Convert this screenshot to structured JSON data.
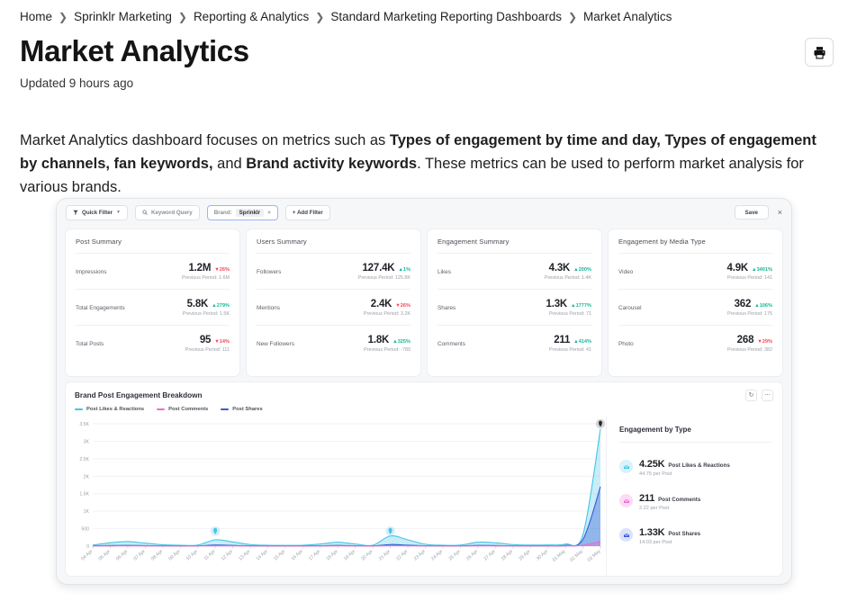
{
  "breadcrumb": [
    "Home",
    "Sprinklr Marketing",
    "Reporting & Analytics",
    "Standard Marketing Reporting Dashboards",
    "Market Analytics"
  ],
  "page": {
    "title": "Market Analytics",
    "updated": "Updated 9 hours ago",
    "print_icon": "print-icon"
  },
  "intro": {
    "p1": "Market Analytics dashboard focuses on metrics such as ",
    "b1": "Types of engagement by time and day, Types of engagement by channels, fan keywords,",
    "p2": " and ",
    "b2": "Brand activity keywords",
    "p3": ". These metrics can be used to perform market analysis for various brands."
  },
  "dashboard": {
    "toolbar": {
      "quick_filter": "Quick Filter",
      "keyword_query": "Keyword Query",
      "brand_label": "Brand:",
      "brand_value": "Sprinklr",
      "brand_remove": "×",
      "add_filter": "+ Add Filter",
      "save": "Save",
      "close": "×"
    },
    "kpi_cards": [
      {
        "title": "Post Summary",
        "items": [
          {
            "label": "Impressions",
            "value": "1.2M",
            "delta": "▼26%",
            "dir": "down",
            "prev": "Previous Period: 1.6M"
          },
          {
            "label": "Total Engagements",
            "value": "5.8K",
            "delta": "▲279%",
            "dir": "up",
            "prev": "Previous Period: 1.5K"
          },
          {
            "label": "Total Posts",
            "value": "95",
            "delta": "▼14%",
            "dir": "down",
            "prev": "Previous Period: 111"
          }
        ]
      },
      {
        "title": "Users Summary",
        "items": [
          {
            "label": "Followers",
            "value": "127.4K",
            "delta": "▲1%",
            "dir": "up",
            "prev": "Previous Period: 125.8K"
          },
          {
            "label": "Mentions",
            "value": "2.4K",
            "delta": "▼26%",
            "dir": "down",
            "prev": "Previous Period: 3.2K"
          },
          {
            "label": "New Followers",
            "value": "1.8K",
            "delta": "▲325%",
            "dir": "up",
            "prev": "Previous Period: -789"
          }
        ]
      },
      {
        "title": "Engagement Summary",
        "items": [
          {
            "label": "Likes",
            "value": "4.3K",
            "delta": "▲200%",
            "dir": "up",
            "prev": "Previous Period: 1.4K"
          },
          {
            "label": "Shares",
            "value": "1.3K",
            "delta": "▲1777%",
            "dir": "up",
            "prev": "Previous Period: 71"
          },
          {
            "label": "Comments",
            "value": "211",
            "delta": "▲414%",
            "dir": "up",
            "prev": "Previous Period: 41"
          }
        ]
      },
      {
        "title": "Engagement by Media Type",
        "items": [
          {
            "label": "Video",
            "value": "4.9K",
            "delta": "▲3401%",
            "dir": "up",
            "prev": "Previous Period: 141"
          },
          {
            "label": "Carousel",
            "value": "362",
            "delta": "▲106%",
            "dir": "up",
            "prev": "Previous Period: 175"
          },
          {
            "label": "Photo",
            "value": "268",
            "delta": "▼29%",
            "dir": "down",
            "prev": "Previous Period: 382"
          }
        ]
      }
    ],
    "chart_card": {
      "title": "Brand Post Engagement Breakdown",
      "refresh_icon": "refresh-icon",
      "more_icon": "more-options-icon"
    },
    "engagement_by_type": {
      "title": "Engagement by Type",
      "items": [
        {
          "value": "4.25K",
          "name": "Post Likes & Reactions",
          "sub": "44.75 per Post",
          "color": "#49c8ea",
          "bg": "#d9f2fb",
          "icon": "inbox-icon"
        },
        {
          "value": "211",
          "name": "Post Comments",
          "sub": "2.22 per Post",
          "color": "#e86fd0",
          "bg": "#fbdcf4",
          "icon": "inbox-icon"
        },
        {
          "value": "1.33K",
          "name": "Post Shares",
          "sub": "14.03 per Post",
          "color": "#3b5bd6",
          "bg": "#dbe2fb",
          "icon": "inbox-icon"
        }
      ]
    }
  },
  "colors": {
    "likes": "#46c4e8",
    "comments": "#e86fd0",
    "shares": "#3b5bd6",
    "up": "#16b897",
    "down": "#f5475b"
  },
  "chart_data": {
    "type": "area",
    "title": "Brand Post Engagement Breakdown",
    "xlabel": "",
    "ylabel": "",
    "ylim": [
      0,
      3500
    ],
    "yticks": [
      0,
      500,
      1000,
      1500,
      2000,
      2500,
      3000,
      3500
    ],
    "ytick_labels": [
      "0",
      "500",
      "1K",
      "1.5K",
      "2K",
      "2.5K",
      "3K",
      "3.5K"
    ],
    "grid": true,
    "legend_position": "top-left",
    "categories": [
      "04 Apr",
      "05 Apr",
      "06 Apr",
      "07 Apr",
      "08 Apr",
      "09 Apr",
      "10 Apr",
      "11 Apr",
      "12 Apr",
      "13 Apr",
      "14 Apr",
      "15 Apr",
      "16 Apr",
      "17 Apr",
      "18 Apr",
      "19 Apr",
      "20 Apr",
      "21 Apr",
      "22 Apr",
      "23 Apr",
      "24 Apr",
      "25 Apr",
      "26 Apr",
      "27 Apr",
      "28 Apr",
      "29 Apr",
      "30 Apr",
      "01 May",
      "02 May",
      "03 May"
    ],
    "series": [
      {
        "name": "Post Likes & Reactions",
        "color": "#46c4e8",
        "values": [
          30,
          95,
          130,
          85,
          40,
          25,
          30,
          180,
          120,
          45,
          25,
          20,
          25,
          60,
          110,
          60,
          25,
          290,
          180,
          55,
          25,
          30,
          110,
          95,
          45,
          30,
          35,
          60,
          330,
          3350
        ]
      },
      {
        "name": "Post Comments",
        "color": "#e86fd0",
        "values": [
          4,
          6,
          8,
          6,
          4,
          3,
          4,
          9,
          7,
          4,
          3,
          3,
          3,
          5,
          7,
          5,
          3,
          12,
          8,
          4,
          3,
          4,
          7,
          6,
          4,
          3,
          4,
          6,
          25,
          130
        ]
      },
      {
        "name": "Post Shares",
        "color": "#3b5bd6",
        "values": [
          10,
          18,
          22,
          16,
          9,
          7,
          9,
          30,
          20,
          10,
          7,
          6,
          7,
          12,
          20,
          12,
          7,
          45,
          28,
          10,
          7,
          9,
          20,
          17,
          9,
          7,
          9,
          20,
          190,
          1700
        ]
      }
    ],
    "annotations": [
      {
        "category": "11 Apr",
        "value": 430,
        "marker": "pin",
        "color": "#46c4e8"
      },
      {
        "category": "21 Apr",
        "value": 430,
        "marker": "pin",
        "color": "#46c4e8"
      },
      {
        "category": "03 May",
        "value": 3500,
        "marker": "pin-dark",
        "color": "#2b2b2b"
      }
    ]
  }
}
